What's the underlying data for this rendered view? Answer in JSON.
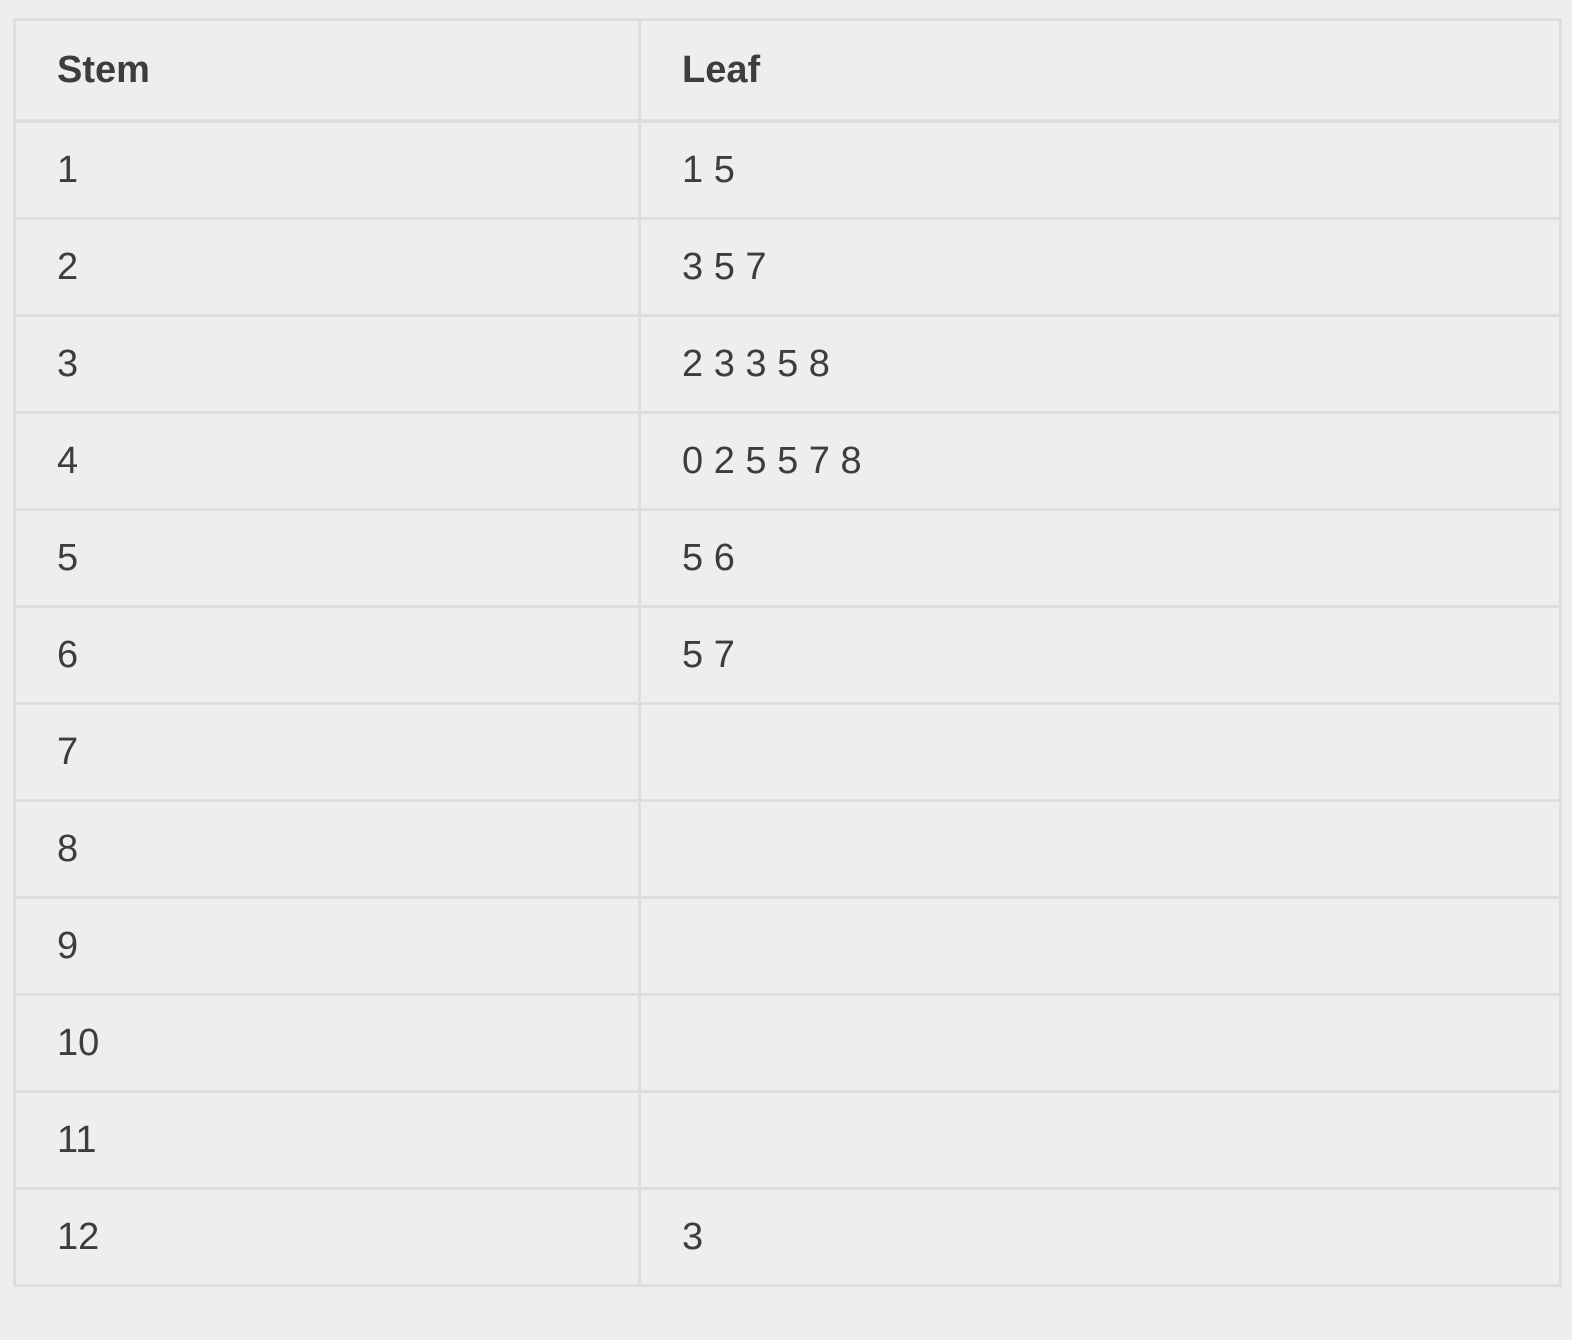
{
  "chart_data": {
    "type": "table",
    "columns": [
      "Stem",
      "Leaf"
    ],
    "rows": [
      {
        "stem": "1",
        "leaf": "1 5"
      },
      {
        "stem": "2",
        "leaf": "3 5 7"
      },
      {
        "stem": "3",
        "leaf": "2 3 3 5 8"
      },
      {
        "stem": "4",
        "leaf": "0 2 5 5 7 8"
      },
      {
        "stem": "5",
        "leaf": "5 6"
      },
      {
        "stem": "6",
        "leaf": "5 7"
      },
      {
        "stem": "7",
        "leaf": ""
      },
      {
        "stem": "8",
        "leaf": ""
      },
      {
        "stem": "9",
        "leaf": ""
      },
      {
        "stem": "10",
        "leaf": ""
      },
      {
        "stem": "11",
        "leaf": ""
      },
      {
        "stem": "12",
        "leaf": "3"
      }
    ]
  },
  "colors": {
    "background": "#eeeeee",
    "border": "#dedede",
    "text": "#3d3d3d"
  }
}
